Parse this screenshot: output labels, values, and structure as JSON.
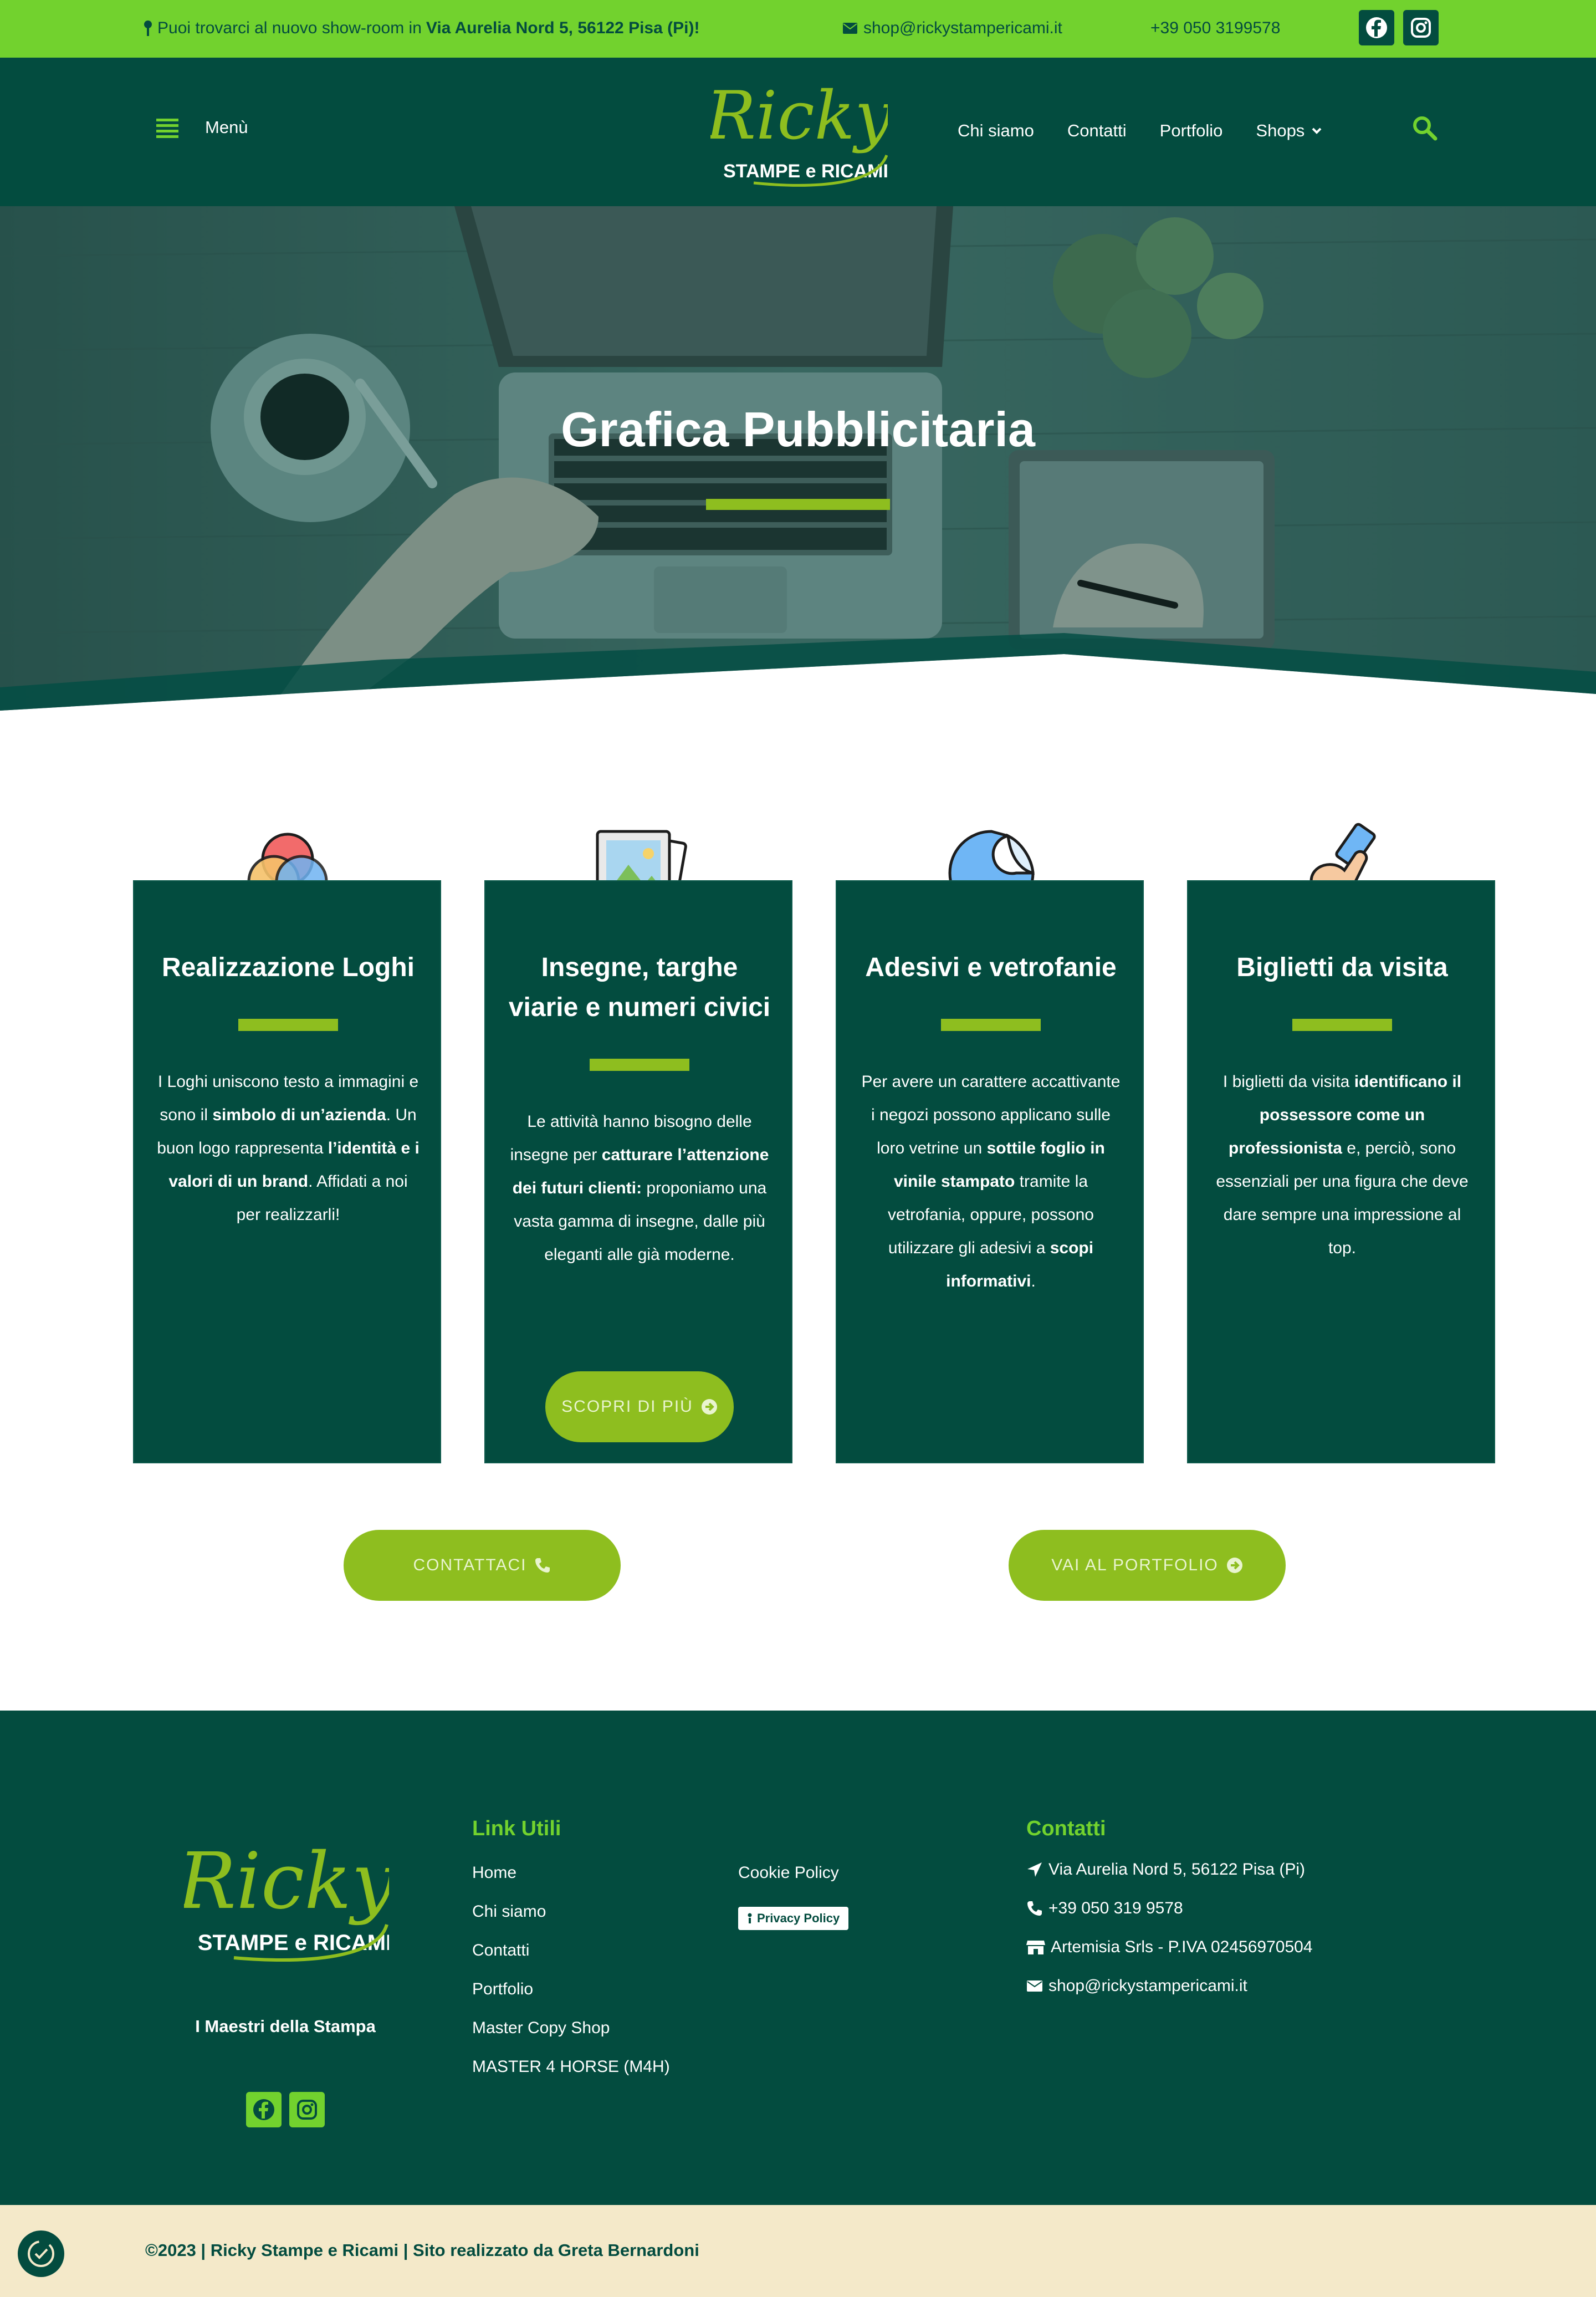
{
  "topbar": {
    "address_prefix": "Puoi trovarci al nuovo show-room in",
    "address_bold": "Via Aurelia Nord 5, 56122 Pisa (Pi)!",
    "email": "shop@rickystampericami.it",
    "phone": "+39 050 3199578",
    "icons": [
      "map-pin-icon",
      "envelope-icon",
      "facebook-icon",
      "instagram-icon"
    ]
  },
  "header": {
    "menu_label": "Menù",
    "logo_script": "Ricky",
    "logo_sub": "STAMPE e RICAMI",
    "nav": [
      "Chi siamo",
      "Contatti",
      "Portfolio",
      "Shops"
    ]
  },
  "hero": {
    "title": "Grafica Pubblicitaria"
  },
  "cards": [
    {
      "title": "Realizzazione Loghi",
      "icon": "color-circles-icon",
      "text_parts": [
        {
          "t": "I Loghi uniscono testo a immagini e sono il ",
          "b": false
        },
        {
          "t": "simbolo di un’azienda",
          "b": true
        },
        {
          "t": ". Un buon logo rappresenta ",
          "b": false
        },
        {
          "t": "l’identità e i valori di un brand",
          "b": true
        },
        {
          "t": ". Affidati a noi per realizzarli!",
          "b": false
        }
      ]
    },
    {
      "title": "Insegne, targhe viarie e numeri civici",
      "icon": "picture-frame-icon",
      "text_parts": [
        {
          "t": "Le attività hanno bisogno delle insegne per ",
          "b": false
        },
        {
          "t": "catturare l’attenzione dei futuri clienti:",
          "b": true
        },
        {
          "t": " proponiamo una vasta gamma di insegne, dalle più eleganti alle già moderne.",
          "b": false
        }
      ],
      "button": "SCOPRI DI PIÙ"
    },
    {
      "title": "Adesivi e vetrofanie",
      "icon": "sticker-icon",
      "text_parts": [
        {
          "t": "Per avere un carattere accattivante i negozi possono applicano sulle loro vetrine un ",
          "b": false
        },
        {
          "t": "sottile foglio in vinile stampato",
          "b": true
        },
        {
          "t": " tramite la vetrofania, oppure, possono utilizzare gli adesivi a ",
          "b": false
        },
        {
          "t": "scopi informativi",
          "b": true
        },
        {
          "t": ".",
          "b": false
        }
      ]
    },
    {
      "title": "Biglietti da visita",
      "icon": "hand-card-icon",
      "text_parts": [
        {
          "t": "I biglietti da visita ",
          "b": false
        },
        {
          "t": "identificano il possessore come un professionista",
          "b": true
        },
        {
          "t": " e, perciò, sono essenziali per una figura che deve dare sempre una impressione al top.",
          "b": false
        }
      ]
    }
  ],
  "cta": {
    "contact": "CONTATTACI",
    "portfolio": "VAI AL PORTFOLIO"
  },
  "footer": {
    "tagline": "I Maestri della Stampa",
    "links_title": "Link Utili",
    "links": [
      "Home",
      "Chi siamo",
      "Contatti",
      "Portfolio",
      "Master Copy Shop",
      "MASTER 4 HORSE (M4H)"
    ],
    "cookie_policy": "Cookie Policy",
    "privacy_badge": "Privacy Policy",
    "contacts_title": "Contatti",
    "contacts": [
      {
        "icon": "location-arrow-icon",
        "text": "Via Aurelia Nord 5, 56122 Pisa (Pi)"
      },
      {
        "icon": "phone-icon",
        "text": "+39 050 319 9578"
      },
      {
        "icon": "store-icon",
        "text": "Artemisia Srls - P.IVA 02456970504"
      },
      {
        "icon": "envelope-icon",
        "text": "shop@rickystampericami.it"
      }
    ]
  },
  "bottom": {
    "copyright": "©2023 | Ricky Stampe e Ricami | Sito realizzato da Greta Bernardoni"
  },
  "colors": {
    "brand_green": "#72d22e",
    "dark_green": "#034c3f",
    "button_green": "#8ebe1f",
    "cream": "#f4e9c9"
  }
}
